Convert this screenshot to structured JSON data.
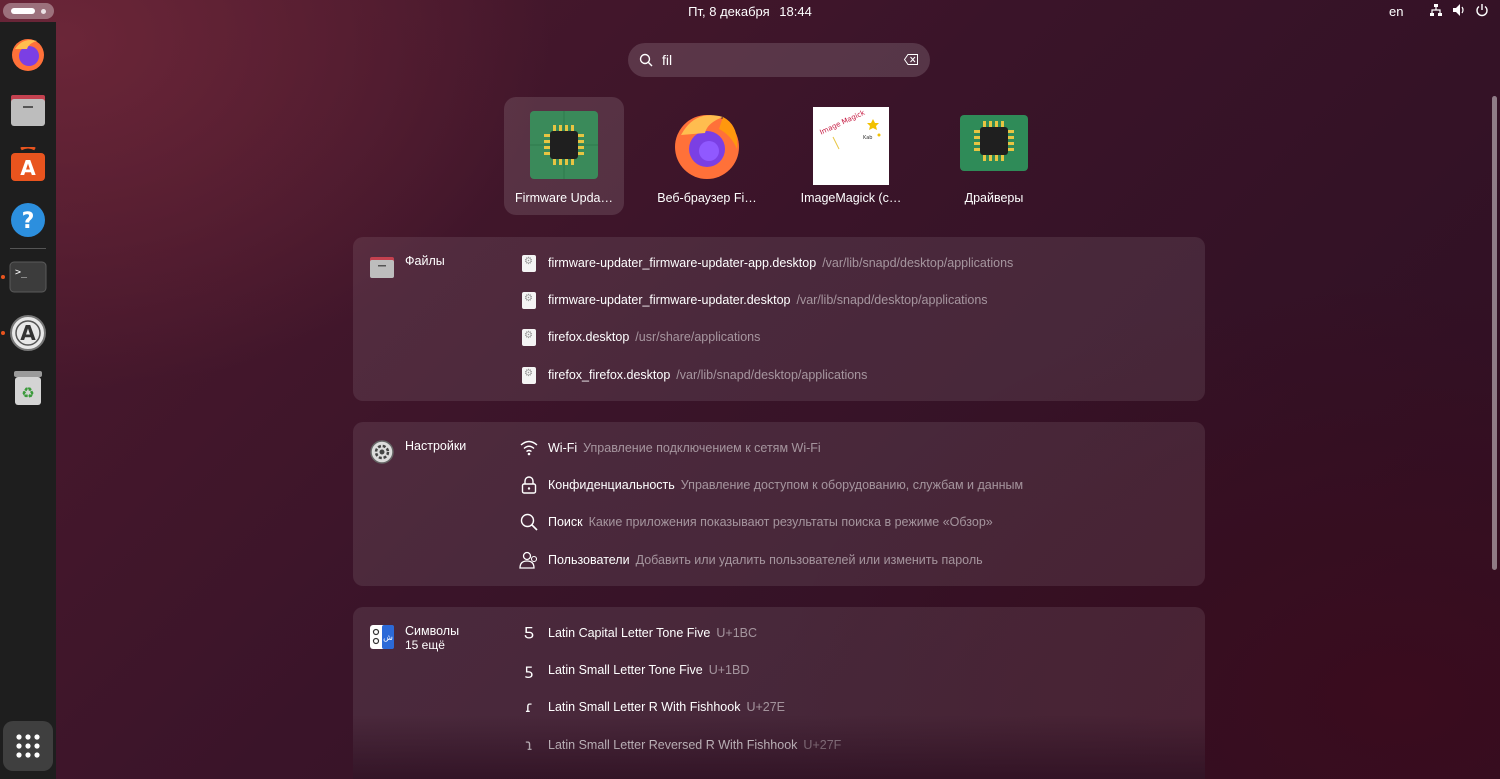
{
  "topbar": {
    "date": "Пт, 8 декабря",
    "time": "18:44",
    "language": "en"
  },
  "search": {
    "value": "fil"
  },
  "apps": [
    {
      "label": "Firmware Upda…",
      "icon": "chip-icon"
    },
    {
      "label": "Веб-браузер Fi…",
      "icon": "firefox-icon"
    },
    {
      "label": "ImageMagick (c…",
      "icon": "imagemagick-icon",
      "icon_text": "Image Magick"
    },
    {
      "label": "Драйверы",
      "icon": "chip-icon"
    }
  ],
  "groups": {
    "files": {
      "title": "Файлы",
      "rows": [
        {
          "title": "firmware-updater_firmware-updater-app.desktop",
          "desc": "/var/lib/snapd/desktop/applications"
        },
        {
          "title": "firmware-updater_firmware-updater.desktop",
          "desc": "/var/lib/snapd/desktop/applications"
        },
        {
          "title": "firefox.desktop",
          "desc": "/usr/share/applications"
        },
        {
          "title": "firefox_firefox.desktop",
          "desc": "/var/lib/snapd/desktop/applications"
        }
      ]
    },
    "settings": {
      "title": "Настройки",
      "rows": [
        {
          "title": "Wi-Fi",
          "desc": "Управление подключением к сетям Wi-Fi",
          "icon": "wifi-icon"
        },
        {
          "title": "Конфиденциальность",
          "desc": "Управление доступом к оборудованию, службам и данным",
          "icon": "lock-icon"
        },
        {
          "title": "Поиск",
          "desc": "Какие приложения показывают результаты поиска в режиме «Обзор»",
          "icon": "search-icon"
        },
        {
          "title": "Пользователи",
          "desc": "Добавить или удалить пользователей или изменить пароль",
          "icon": "users-icon"
        }
      ]
    },
    "symbols": {
      "title": "Символы",
      "subtitle": "15 ещё",
      "rows": [
        {
          "glyph": "Ƽ",
          "title": "Latin Capital Letter Tone Five",
          "desc": "U+1BC"
        },
        {
          "glyph": "ƽ",
          "title": "Latin Small Letter Tone Five",
          "desc": "U+1BD"
        },
        {
          "glyph": "ɾ",
          "title": "Latin Small Letter R With Fishhook",
          "desc": "U+27E"
        },
        {
          "glyph": "ɿ",
          "title": "Latin Small Letter Reversed R With Fishhook",
          "desc": "U+27F"
        }
      ]
    }
  },
  "colors": {
    "dock": "#1e1e1e",
    "running_indicator": "#e9541e",
    "chip_green": "#3a8a5a"
  }
}
